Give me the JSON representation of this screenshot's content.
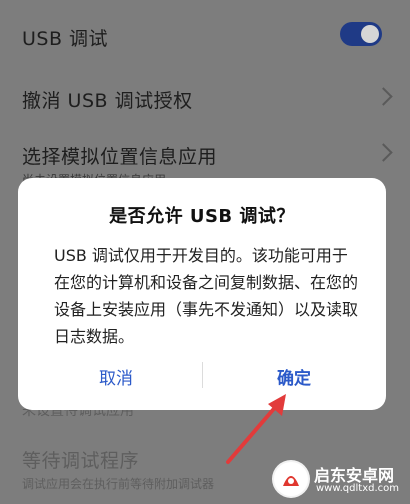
{
  "settings": {
    "usb_debug": {
      "label": "USB 调试",
      "enabled": true
    },
    "revoke": {
      "label": "撤消 USB 调试授权"
    },
    "mock_location": {
      "label": "选择模拟位置信息应用",
      "sub": "尚未设置模拟位置信息应用"
    },
    "obscured": {
      "label": "未设置待调试应用"
    },
    "wait_debugger": {
      "label": "等待调试程序",
      "sub": "调试应用会在执行前等待附加调试器"
    }
  },
  "dialog": {
    "title": "是否允许 USB 调试？",
    "body": "USB 调试仅用于开发目的。该功能可用于在您的计算机和设备之间复制数据、在您的设备上安装应用（事先不发通知）以及读取日志数据。",
    "cancel": "取消",
    "ok": "确定"
  },
  "watermark": {
    "name": "启东安卓网",
    "url": "www.qdltxd.com"
  },
  "colors": {
    "accent": "#2c5ac9",
    "toggle": "#1f3a86",
    "arrow": "#e23b3b"
  }
}
